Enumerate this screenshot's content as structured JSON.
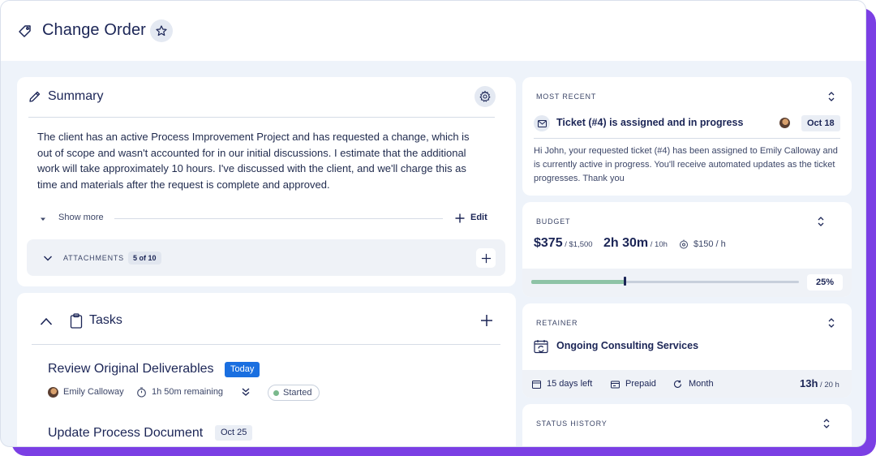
{
  "header": {
    "title": "Change Order"
  },
  "summary": {
    "title": "Summary",
    "text": "The client has an active Process Improvement Project and has requested a change, which is out of scope and wasn't accounted for in our initial discussions. I estimate that the additional work will take approximately 10 hours. I've discussed with the client, and we'll charge this as time and materials after the request is complete and approved.",
    "show_more": "Show more",
    "edit": "Edit",
    "attachments_label": "ATTACHMENTS",
    "attachments_count": "5 of 10"
  },
  "tasks": {
    "title": "Tasks",
    "items": [
      {
        "title": "Review Original Deliverables",
        "badge": "Today",
        "assignee": "Emily Calloway",
        "remaining": "1h 50m remaining",
        "status": "Started"
      },
      {
        "title": "Update Process Document",
        "badge": "Oct 25"
      }
    ]
  },
  "most_recent": {
    "label": "MOST RECENT",
    "title": "Ticket (#4) is assigned and in progress",
    "date": "Oct 18",
    "message": "Hi John, your requested ticket (#4) has been assigned to Emily Calloway and is currently active in progress. You'll receive automated updates as the ticket progresses. Thank you"
  },
  "budget": {
    "label": "BUDGET",
    "spent": "$375",
    "spent_total": " / $1,500",
    "time": "2h 30m",
    "time_total": " / 10h",
    "rate": "$150 / h",
    "progress_label": "25%",
    "progress_value": 0.35
  },
  "retainer": {
    "label": "RETAINER",
    "name": "Ongoing Consulting Services",
    "days_left": "15 days left",
    "billing": "Prepaid",
    "period": "Month",
    "hours_used": "13h",
    "hours_total": " / 20 h"
  },
  "status_history": {
    "label": "STATUS HISTORY"
  },
  "colors": {
    "accent": "#7b3fe4",
    "today_badge": "#1a6fe0",
    "progress": "#8ec3a6",
    "status_started": "#7ab98c"
  },
  "icons": [
    "tag-icon",
    "star-icon",
    "pencil-icon",
    "gear-icon",
    "caret-down-icon",
    "plus-icon",
    "chevron-down-icon",
    "chevron-up-icon",
    "clipboard-icon",
    "timer-icon",
    "double-chevron-down-icon",
    "mail-icon",
    "updown-chevron-icon",
    "rate-icon",
    "calendar-refresh-icon",
    "calendar-icon",
    "prepaid-icon",
    "refresh-icon"
  ]
}
